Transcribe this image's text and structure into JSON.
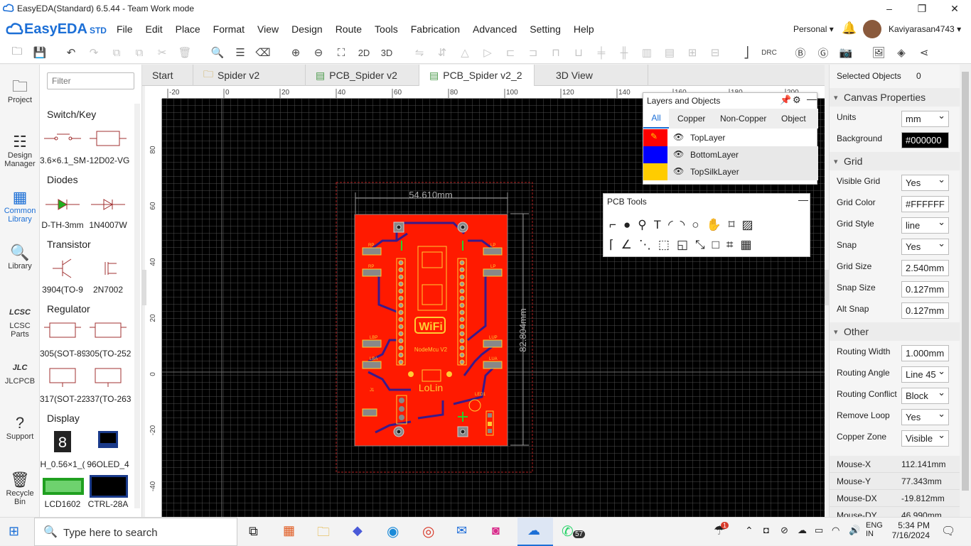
{
  "window": {
    "title": "EasyEDA(Standard) 6.5.44 - Team Work mode"
  },
  "menu": {
    "logo": "EasyEDA",
    "logo_sub": "STD",
    "items": [
      "File",
      "Edit",
      "Place",
      "Format",
      "View",
      "Design",
      "Route",
      "Tools",
      "Fabrication",
      "Advanced",
      "Setting",
      "Help"
    ],
    "workspace": "Personal",
    "user": "Kaviyarasan4743"
  },
  "toolbar": {
    "btn_2d": "2D",
    "btn_3d": "3D",
    "btn_drc": "DRC"
  },
  "leftnav": [
    {
      "label": "Project",
      "icon": "folder-icon"
    },
    {
      "label": "Design Manager",
      "icon": "list-icon"
    },
    {
      "label": "Common Library",
      "icon": "chip-icon"
    },
    {
      "label": "Library",
      "icon": "search-icon"
    },
    {
      "label": "LCSC Parts",
      "icon": "lcsc-icon"
    },
    {
      "label": "JLCPCB",
      "icon": "jlc-icon"
    },
    {
      "label": "Support",
      "icon": "help-icon"
    },
    {
      "label": "Recycle Bin",
      "icon": "trash-icon"
    }
  ],
  "library": {
    "filter_placeholder": "Filter",
    "categories": [
      "Switch/Key",
      "Diodes",
      "Transistor",
      "Regulator",
      "Display"
    ],
    "items": [
      "3.6×6.1_SM",
      "-12D02-VG",
      "D-TH-3mm",
      "1N4007W",
      "3904(TO-9",
      "2N7002",
      "305(SOT-89",
      "305(TO-252",
      "317(SOT-22",
      "337(TO-263",
      "H_0.56×1_(",
      "96OLED_4",
      "LCD1602",
      "CTRL-28A"
    ]
  },
  "tabs": [
    "Start",
    "Spider v2",
    "PCB_Spider v2",
    "PCB_Spider v2_2",
    "3D View"
  ],
  "ruler": {
    "h": [
      "-20",
      "0",
      "20",
      "40",
      "60",
      "80",
      "100",
      "120",
      "140",
      "160",
      "180",
      "200"
    ],
    "v": [
      "80",
      "60",
      "40",
      "20",
      "0",
      "-20",
      "-40"
    ]
  },
  "board": {
    "dim_width": "54.610mm",
    "dim_height": "82.804mm",
    "module_text": "WiFi",
    "brand": "LoLin",
    "module_name": "NodeMcu V2",
    "labels": [
      "LP",
      "LP",
      "RP",
      "RP",
      "LBP",
      "LBA",
      "LUP",
      "LUA",
      "LED1",
      "J1",
      "JP1",
      "R1",
      "R2",
      "R3"
    ]
  },
  "layers": {
    "title": "Layers and Objects",
    "tabs": [
      "All",
      "Copper",
      "Non-Copper",
      "Object"
    ],
    "rows": [
      {
        "name": "TopLayer",
        "color": "#ff0000"
      },
      {
        "name": "BottomLayer",
        "color": "#0000ff"
      },
      {
        "name": "TopSilkLayer",
        "color": "#ffcc00"
      }
    ]
  },
  "pcbtools": {
    "title": "PCB Tools"
  },
  "props": {
    "selected_label": "Selected Objects",
    "selected_count": "0",
    "canvas_title": "Canvas Properties",
    "units_label": "Units",
    "units": "mm",
    "bg_label": "Background",
    "bg": "#000000",
    "grid_title": "Grid",
    "visible_grid_label": "Visible Grid",
    "visible_grid": "Yes",
    "grid_color_label": "Grid Color",
    "grid_color": "#FFFFFF",
    "grid_style_label": "Grid Style",
    "grid_style": "line",
    "snap_label": "Snap",
    "snap": "Yes",
    "grid_size_label": "Grid Size",
    "grid_size": "2.540mm",
    "snap_size_label": "Snap Size",
    "snap_size": "0.127mm",
    "alt_snap_label": "Alt Snap",
    "alt_snap": "0.127mm",
    "other_title": "Other",
    "routing_width_label": "Routing Width",
    "routing_width": "1.000mm",
    "routing_angle_label": "Routing Angle",
    "routing_angle": "Line 45",
    "routing_conflict_label": "Routing Conflict",
    "routing_conflict": "Block",
    "remove_loop_label": "Remove Loop",
    "remove_loop": "Yes",
    "copper_zone_label": "Copper Zone",
    "copper_zone": "Visible",
    "mouse": [
      {
        "k": "Mouse-X",
        "v": "112.141mm"
      },
      {
        "k": "Mouse-Y",
        "v": "77.343mm"
      },
      {
        "k": "Mouse-DX",
        "v": "-19.812mm"
      },
      {
        "k": "Mouse-DY",
        "v": "46.990mm"
      }
    ]
  },
  "taskbar": {
    "search": "Type here to search",
    "lang1": "ENG",
    "lang2": "IN",
    "time": "5:34 PM",
    "date": "7/16/2024",
    "badge": "57",
    "mail_badge": "1"
  }
}
